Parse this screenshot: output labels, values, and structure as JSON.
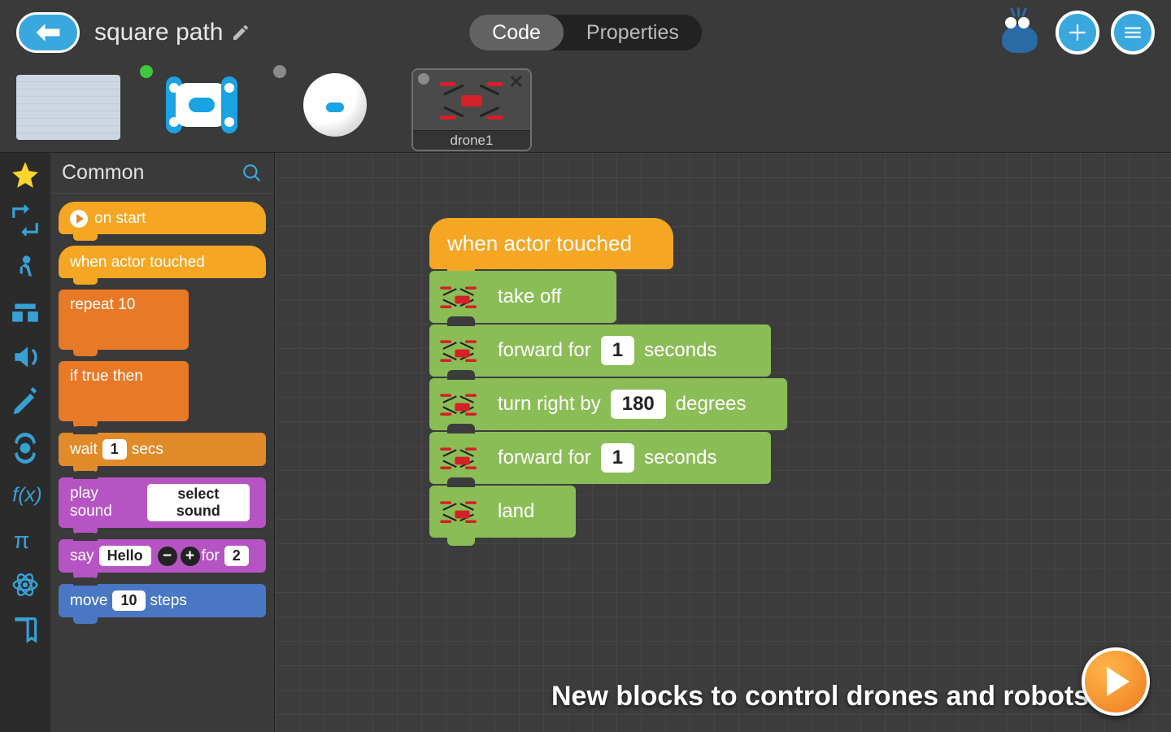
{
  "header": {
    "title": "square path",
    "tabs": {
      "code": "Code",
      "properties": "Properties",
      "active": "code"
    }
  },
  "actors": {
    "selected_label": "drone1",
    "close_glyph": "✕"
  },
  "palette": {
    "category_label": "Common",
    "blocks": {
      "on_start": "on start",
      "when_actor_touched": "when actor touched",
      "repeat_label": "repeat",
      "repeat_val": "10",
      "if_label": "if",
      "if_cond": "true",
      "then_label": "then",
      "wait_label": "wait",
      "wait_val": "1",
      "wait_unit": "secs",
      "play_sound_label": "play sound",
      "play_sound_val": "select sound",
      "say_label": "say",
      "say_val": "Hello",
      "say_for": "for",
      "say_dur": "2",
      "move_label": "move",
      "move_val": "10",
      "move_unit": "steps"
    }
  },
  "script": {
    "hat": "when actor touched",
    "take_off": "take off",
    "forward_label": "forward for",
    "forward_unit": "seconds",
    "forward1_val": "1",
    "turn_label": "turn right by",
    "turn_val": "180",
    "turn_unit": "degrees",
    "forward2_val": "1",
    "land": "land"
  },
  "banner": "New blocks to control drones and robots"
}
